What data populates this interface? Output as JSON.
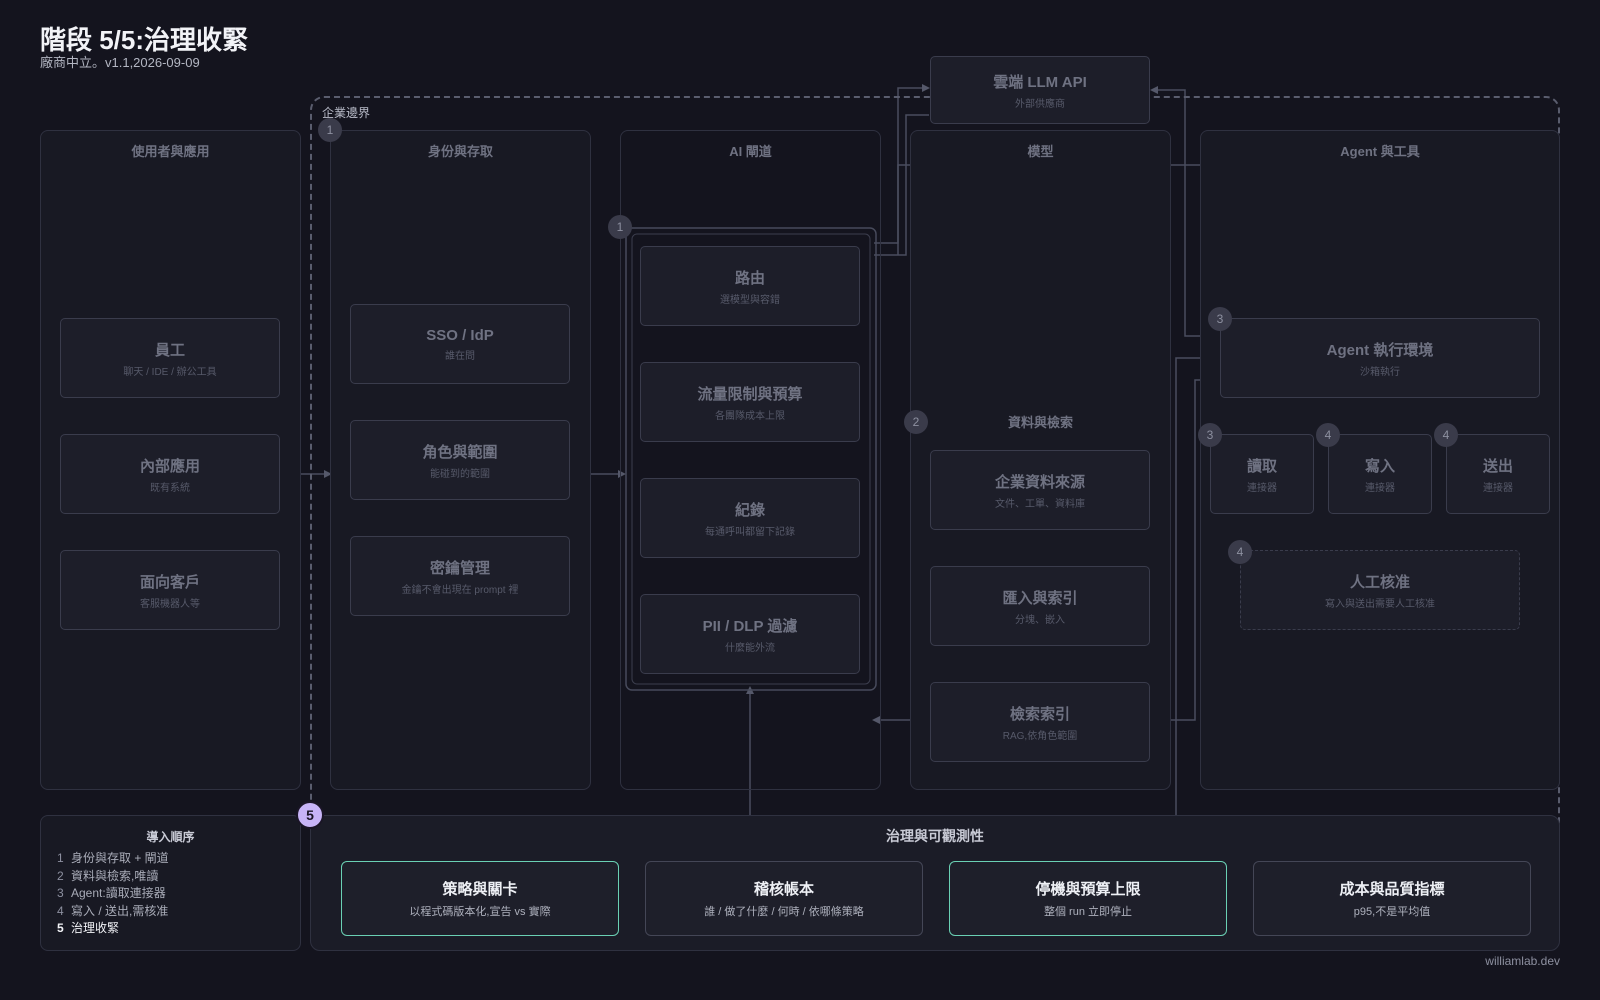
{
  "header": {
    "title": "階段 5/5:治理收緊",
    "subtitle": "廠商中立。v1.1,2026-09-09"
  },
  "boundary_label": "企業邊界",
  "external": {
    "title": "雲端 LLM API",
    "sub": "外部供應商"
  },
  "columns": {
    "users": {
      "title": "使用者與應用",
      "boxes": [
        {
          "title": "員工",
          "sub": "聊天 / IDE / 辦公工具"
        },
        {
          "title": "內部應用",
          "sub": "既有系統"
        },
        {
          "title": "面向客戶",
          "sub": "客服機器人等"
        }
      ]
    },
    "identity": {
      "title": "身份與存取",
      "badge": "1",
      "boxes": [
        {
          "title": "SSO / IdP",
          "sub": "誰在問"
        },
        {
          "title": "角色與範圍",
          "sub": "能碰到的範圍"
        },
        {
          "title": "密鑰管理",
          "sub": "金鑰不會出現在 prompt 裡"
        }
      ]
    },
    "gateway": {
      "title": "AI 閘道",
      "badge": "1",
      "boxes": [
        {
          "title": "路由",
          "sub": "選模型與容錯"
        },
        {
          "title": "流量限制與預算",
          "sub": "各團隊成本上限"
        },
        {
          "title": "紀錄",
          "sub": "每通呼叫都留下記錄"
        },
        {
          "title": "PII / DLP 過濾",
          "sub": "什麼能外流"
        }
      ]
    },
    "models": {
      "title": "模型",
      "subsection": "資料與檢索",
      "badge": "2",
      "boxes": [
        {
          "title": "企業資料來源",
          "sub": "文件、工單、資料庫"
        },
        {
          "title": "匯入與索引",
          "sub": "分塊、嵌入"
        },
        {
          "title": "檢索索引",
          "sub": "RAG,依角色範圍"
        }
      ]
    },
    "agents": {
      "title": "Agent 與工具",
      "runtime": {
        "title": "Agent 執行環境",
        "sub": "沙箱執行",
        "badge": "3"
      },
      "connectors": [
        {
          "title": "讀取",
          "sub": "連接器",
          "badge": "3"
        },
        {
          "title": "寫入",
          "sub": "連接器",
          "badge": "4"
        },
        {
          "title": "送出",
          "sub": "連接器",
          "badge": "4"
        }
      ],
      "approval": {
        "title": "人工核准",
        "sub": "寫入與送出需要人工核准",
        "badge": "4"
      }
    }
  },
  "legend": {
    "title": "導入順序",
    "items": [
      {
        "n": "1",
        "text": "身份與存取 + 閘道"
      },
      {
        "n": "2",
        "text": "資料與檢索,唯讀"
      },
      {
        "n": "3",
        "text": "Agent:讀取連接器"
      },
      {
        "n": "4",
        "text": "寫入 / 送出,需核准"
      },
      {
        "n": "5",
        "text": "治理收緊"
      }
    ]
  },
  "governance": {
    "badge": "5",
    "title": "治理與可觀測性",
    "cards": [
      {
        "title": "策略與關卡",
        "sub": "以程式碼版本化,宣告 vs 實際"
      },
      {
        "title": "稽核帳本",
        "sub": "誰 / 做了什麼 / 何時 / 依哪條策略"
      },
      {
        "title": "停機與預算上限",
        "sub": "整個 run 立即停止"
      },
      {
        "title": "成本與品質指標",
        "sub": "p95,不是平均值"
      }
    ]
  },
  "colors": {
    "accent": "#c7b4f7",
    "highlight": "#6ad0b4",
    "background": "#14141e"
  },
  "credit": "williamlab.dev"
}
